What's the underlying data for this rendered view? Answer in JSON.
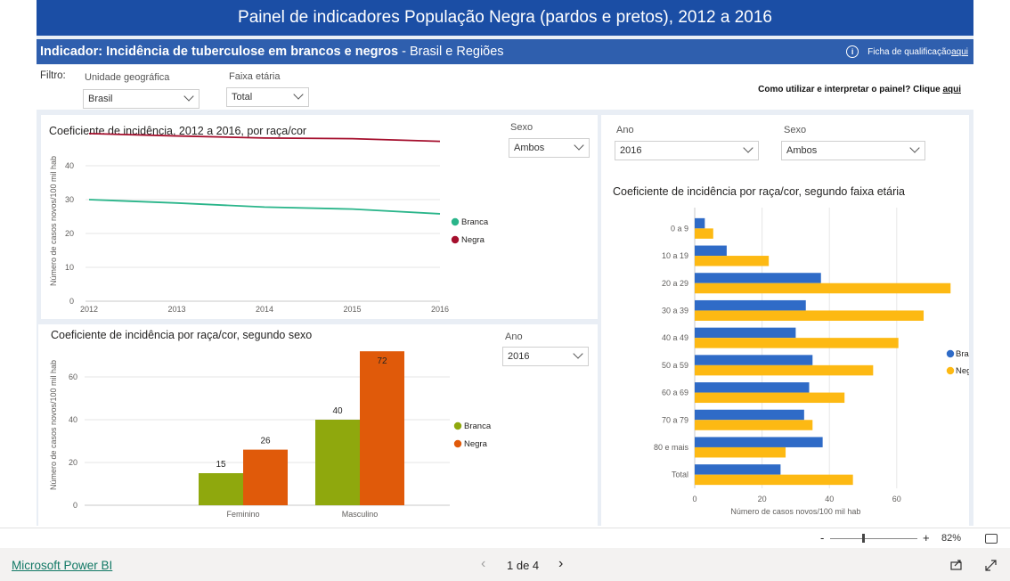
{
  "header": {
    "title": "Painel de indicadores População Negra (pardos e pretos), 2012 a 2016",
    "indicator_bold": "Indicador: Incidência de tuberculose em brancos e negros",
    "indicator_rest": " - Brasil e Regiões",
    "ficha_text": "Ficha de qualificação ",
    "ficha_link": "aqui"
  },
  "filters": {
    "label": "Filtro:",
    "geo_label": "Unidade geográfica",
    "geo_value": "Brasil",
    "age_label": "Faixa etária",
    "age_value": "Total",
    "help_text": "Como utilizar e interpretar o painel? Clique ",
    "help_link": "aqui"
  },
  "line_panel": {
    "title": "Coeficiente de incidência, 2012 a 2016, por raça/cor",
    "sexo_label": "Sexo",
    "sexo_value": "Ambos"
  },
  "sex_panel": {
    "title": "Coeficiente de incidência por raça/cor, segundo sexo",
    "ano_label": "Ano",
    "ano_value": "2016"
  },
  "age_panel": {
    "ano_label": "Ano",
    "ano_value": "2016",
    "sexo_label": "Sexo",
    "sexo_value": "Ambos",
    "title": "Coeficiente de incidência por raça/cor, segundo faixa etária"
  },
  "colors": {
    "banner": "#1b4ea5",
    "subbar": "#2f5fae",
    "line_branca": "#2ab58a",
    "line_negra": "#a50f2d",
    "bar_branca_sex": "#8fa80d",
    "bar_negra_sex": "#e05a0a",
    "bar_branca_age": "#2f6bc7",
    "bar_negra_age": "#fdb913"
  },
  "chart_data": [
    {
      "type": "line",
      "x": [
        "2012",
        "2013",
        "2014",
        "2015",
        "2016"
      ],
      "ylabel": "Número de casos novos/100 mil hab",
      "ylim": [
        0,
        50
      ],
      "yticks": [
        0,
        10,
        20,
        30,
        40
      ],
      "series": [
        {
          "name": "Branca",
          "values": [
            30,
            29,
            27.8,
            27.2,
            25.8
          ]
        },
        {
          "name": "Negra",
          "values": [
            49.5,
            48.8,
            48.2,
            48.0,
            47.2
          ]
        }
      ],
      "legend": "right"
    },
    {
      "type": "bar",
      "categories": [
        "Feminino",
        "Masculino"
      ],
      "ylabel": "Número de casos novos/100 mil hab",
      "ylim": [
        0,
        75
      ],
      "yticks": [
        0,
        20,
        40,
        60
      ],
      "series": [
        {
          "name": "Branca",
          "values": [
            15,
            40
          ]
        },
        {
          "name": "Negra",
          "values": [
            26,
            72
          ]
        }
      ],
      "legend": "right"
    },
    {
      "type": "bar",
      "orientation": "horizontal",
      "categories": [
        "0 a 9",
        "10 a 19",
        "20 a 29",
        "30 a 39",
        "40 a 49",
        "50 a 59",
        "60 a 69",
        "70 a 79",
        "80 e mais",
        "Total"
      ],
      "xlabel": "Número de casos novos/100 mil hab",
      "xlim": [
        0,
        76
      ],
      "xticks": [
        0,
        20,
        40,
        60
      ],
      "series": [
        {
          "name": "Branca",
          "values": [
            3,
            9.5,
            37.5,
            33,
            30,
            35,
            34,
            32.5,
            38,
            25.5
          ]
        },
        {
          "name": "Negra",
          "values": [
            5.5,
            22,
            76,
            68,
            60.5,
            53,
            44.5,
            35,
            27,
            47
          ]
        }
      ],
      "legend": "right"
    }
  ],
  "zoom": {
    "minus": "-",
    "plus": "+",
    "level": "82%"
  },
  "footer": {
    "brand": "Microsoft Power BI",
    "page": "1 de 4"
  }
}
